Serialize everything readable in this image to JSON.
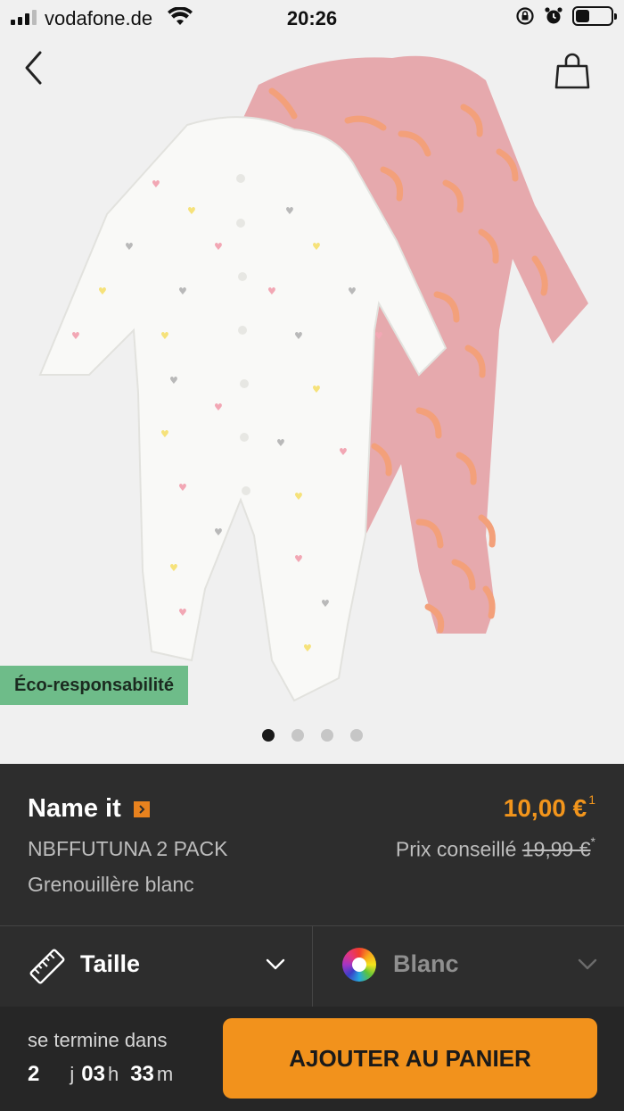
{
  "status_bar": {
    "carrier": "vodafone.de",
    "time": "20:26"
  },
  "product_image": {
    "badge": "Éco-responsabilité",
    "page_count": 4,
    "active_page": 1
  },
  "product": {
    "brand": "Name it",
    "price": "10,00 €",
    "price_footnote": "1",
    "name": "NBFFUTUNA 2 PACK",
    "description": "Grenouillère blanc",
    "rrp_label": "Prix conseillé",
    "rrp_value": "19,99 €",
    "rrp_footnote": "*"
  },
  "selectors": {
    "size_label": "Taille",
    "color_label": "Blanc"
  },
  "bottom": {
    "ends_label": "se termine dans",
    "days": "2",
    "days_unit": "j",
    "hours": "03",
    "hours_unit": "h",
    "minutes": "33",
    "minutes_unit": "m",
    "cart_button": "AJOUTER AU PANIER"
  },
  "colors": {
    "accent": "#f2921c",
    "eco_green": "#6ebc89",
    "dark_bg": "#2d2d2d"
  }
}
